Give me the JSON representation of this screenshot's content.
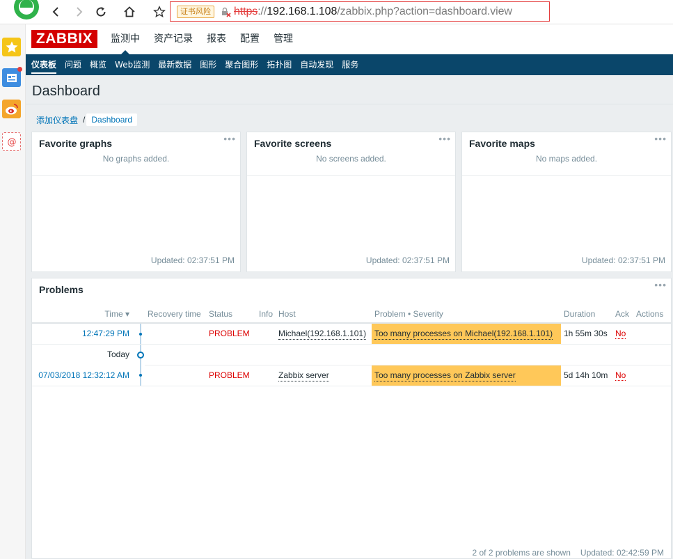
{
  "browser": {
    "cert_warning": "证书风险",
    "url_protocol": "https",
    "url_sep": "://",
    "url_host": "192.168.1.108",
    "url_path": "/zabbix.php?action=dashboard.view"
  },
  "logo": "ZABBIX",
  "top_menu": [
    "监测中",
    "资产记录",
    "报表",
    "配置",
    "管理"
  ],
  "sub_menu": [
    "仪表板",
    "问题",
    "概览",
    "Web监测",
    "最新数据",
    "图形",
    "聚合图形",
    "拓扑图",
    "自动发现",
    "服务"
  ],
  "page_title": "Dashboard",
  "breadcrumb": {
    "link": "添加仪表盘",
    "sep": "/",
    "current": "Dashboard"
  },
  "widgets": [
    {
      "title": "Favorite graphs",
      "empty": "No graphs added.",
      "updated": "Updated: 02:37:51 PM"
    },
    {
      "title": "Favorite screens",
      "empty": "No screens added.",
      "updated": "Updated: 02:37:51 PM"
    },
    {
      "title": "Favorite maps",
      "empty": "No maps added.",
      "updated": "Updated: 02:37:51 PM"
    }
  ],
  "widget_menu": "•••",
  "problems": {
    "title": "Problems",
    "columns": {
      "time": "Time ▾",
      "recovery": "Recovery time",
      "status": "Status",
      "info": "Info",
      "host": "Host",
      "problem": "Problem • Severity",
      "duration": "Duration",
      "ack": "Ack",
      "actions": "Actions"
    },
    "rows": [
      {
        "time": "12:47:29 PM",
        "status": "PROBLEM",
        "host": "Michael(192.168.1.101)",
        "problem": "Too many processes on Michael(192.168.1.101)",
        "duration": "1h 55m 30s",
        "ack": "No"
      },
      {
        "time": "07/03/2018 12:32:12 AM",
        "status": "PROBLEM",
        "host": "Zabbix server",
        "problem": "Too many processes on Zabbix server",
        "duration": "5d 14h 10m",
        "ack": "No"
      }
    ],
    "today_label": "Today",
    "footer_count": "2 of 2 problems are shown",
    "footer_updated": "Updated: 02:42:59 PM"
  },
  "colors": {
    "brand": "#d40000",
    "subnav": "#0a466a",
    "severity_average": "#ffc859",
    "problem": "#dc0000",
    "link": "#0275b8"
  }
}
